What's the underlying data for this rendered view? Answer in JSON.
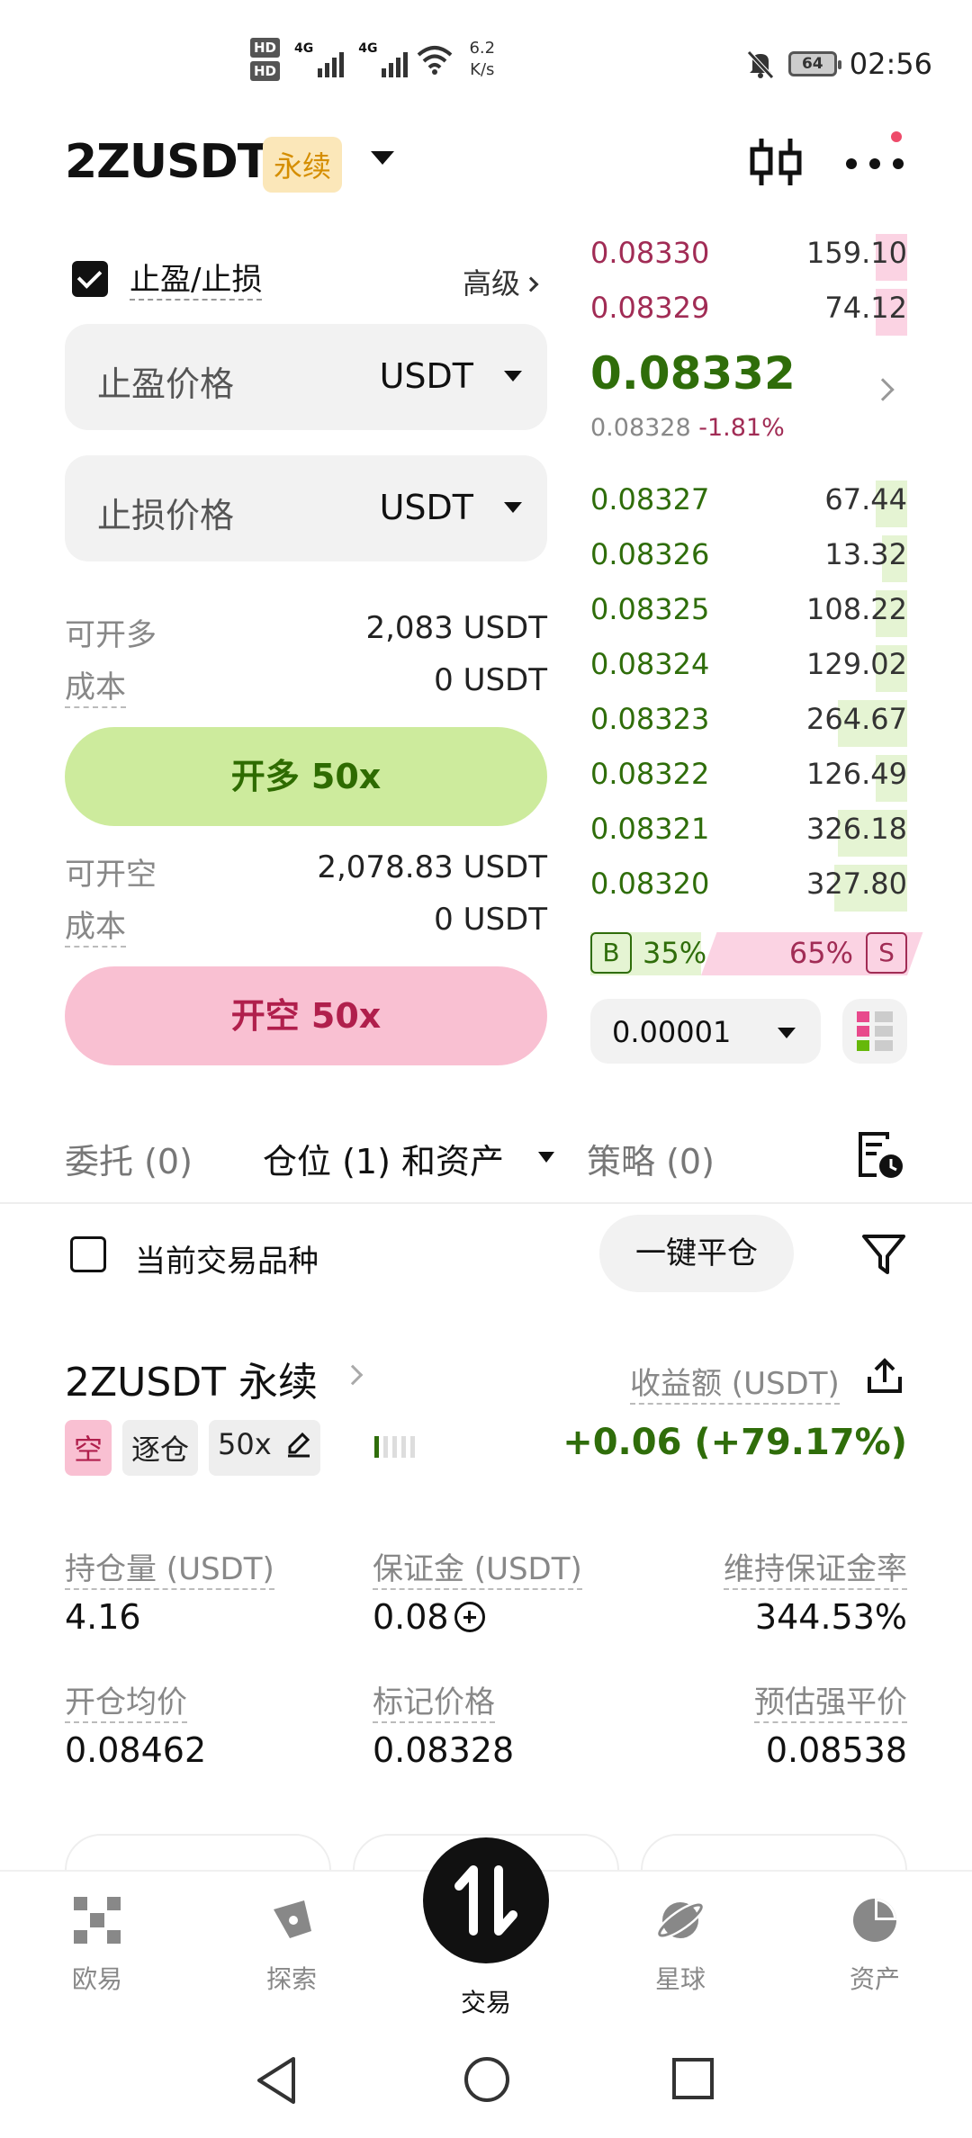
{
  "status_bar": {
    "hd1": "HD",
    "hd2": "HD",
    "signal1_label": "4G",
    "signal2_label": "4G",
    "net_speed_value": "6.2",
    "net_speed_unit": "K/s",
    "battery": "64",
    "time": "02:56"
  },
  "header": {
    "pair": "2ZUSDT",
    "contract_badge": "永续"
  },
  "order_form": {
    "tp_sl_label": "止盈/止损",
    "tp_sl_checked": true,
    "advanced_label": "高级",
    "take_profit_placeholder": "止盈价格",
    "take_profit_unit": "USDT",
    "stop_loss_placeholder": "止损价格",
    "stop_loss_unit": "USDT",
    "long_available_label": "可开多",
    "long_available_value": "2,083 USDT",
    "long_cost_label": "成本",
    "long_cost_value": "0 USDT",
    "long_button": "开多 50x",
    "short_available_label": "可开空",
    "short_available_value": "2,078.83 USDT",
    "short_cost_label": "成本",
    "short_cost_value": "0 USDT",
    "short_button": "开空 50x"
  },
  "order_book": {
    "asks": [
      {
        "price": "0.08330",
        "qty": "159.10",
        "depth": 0.1
      },
      {
        "price": "0.08329",
        "qty": "74.12",
        "depth": 0.1
      }
    ],
    "last_price": "0.08332",
    "mark_price": "0.08328",
    "change_pct": "-1.81%",
    "bids": [
      {
        "price": "0.08327",
        "qty": "67.44",
        "depth": 0.1
      },
      {
        "price": "0.08326",
        "qty": "13.32",
        "depth": 0.08
      },
      {
        "price": "0.08325",
        "qty": "108.22",
        "depth": 0.1
      },
      {
        "price": "0.08324",
        "qty": "129.02",
        "depth": 0.1
      },
      {
        "price": "0.08323",
        "qty": "264.67",
        "depth": 0.22
      },
      {
        "price": "0.08322",
        "qty": "126.49",
        "depth": 0.1
      },
      {
        "price": "0.08321",
        "qty": "326.18",
        "depth": 0.22
      },
      {
        "price": "0.08320",
        "qty": "327.80",
        "depth": 0.23
      }
    ],
    "buy_label": "B",
    "buy_pct": "35%",
    "sell_label": "S",
    "sell_pct": "65%",
    "buy_ratio": 0.35,
    "precision": "0.00001"
  },
  "tabs": {
    "orders": "委托 (0)",
    "positions": "仓位 (1) 和资产",
    "strategies": "策略 (0)"
  },
  "filter": {
    "current_pair_label": "当前交易品种",
    "close_all_button": "一键平仓"
  },
  "position": {
    "title": "2ZUSDT 永续",
    "pnl_label": "收益额 (USDT)",
    "side_tag": "空",
    "margin_mode_tag": "逐仓",
    "leverage_tag": "50x",
    "pnl_value": "+0.06 (+79.17%)",
    "size_label": "持仓量 (USDT)",
    "size_value": "4.16",
    "margin_label": "保证金 (USDT)",
    "margin_value": "0.08",
    "mmr_label": "维持保证金率",
    "mmr_value": "344.53%",
    "entry_label": "开仓均价",
    "entry_value": "0.08462",
    "mark_label": "标记价格",
    "mark_value": "0.08328",
    "liq_label": "预估强平价",
    "liq_value": "0.08538"
  },
  "bottom_nav": {
    "items": [
      "欧易",
      "探索",
      "交易",
      "星球",
      "资产"
    ]
  }
}
